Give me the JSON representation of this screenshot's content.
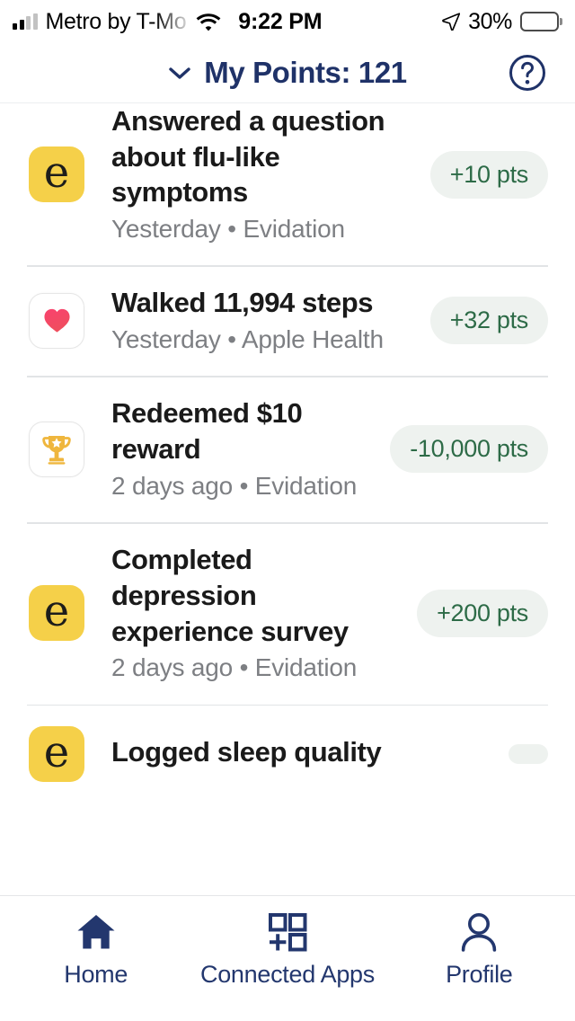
{
  "status_bar": {
    "carrier": "Metro by T-Mo",
    "time": "9:22 PM",
    "battery_percent": "30%",
    "battery_level": 30,
    "signal_icon": "signal-bars-icon",
    "wifi_icon": "wifi-icon",
    "location_icon": "location-arrow-icon",
    "battery_icon": "battery-icon"
  },
  "header": {
    "title": "My Points: 121",
    "points": 121,
    "dropdown_icon": "chevron-down-icon",
    "help_icon": "help-circle-icon"
  },
  "activity_list": [
    {
      "icon": "evidation-e-icon",
      "title": "Answered a question about flu-like symptoms",
      "subtitle": "Yesterday • Evidation",
      "badge": "+10 pts"
    },
    {
      "icon": "apple-health-heart-icon",
      "title": "Walked 11,994 steps",
      "subtitle": "Yesterday • Apple Health",
      "badge": "+32 pts"
    },
    {
      "icon": "trophy-icon",
      "title": "Redeemed $10 reward",
      "subtitle": "2 days ago • Evidation",
      "badge": "-10,000 pts"
    },
    {
      "icon": "evidation-e-icon",
      "title": "Completed depression experience survey",
      "subtitle": "2 days ago • Evidation",
      "badge": "+200 pts"
    },
    {
      "icon": "evidation-e-icon",
      "title": "Logged sleep quality",
      "subtitle": "",
      "badge": ""
    }
  ],
  "tabbar": [
    {
      "label": "Home",
      "icon": "home-icon"
    },
    {
      "label": "Connected Apps",
      "icon": "connected-apps-icon"
    },
    {
      "label": "Profile",
      "icon": "person-icon"
    }
  ],
  "colors": {
    "navy": "#1f3268",
    "badge_bg": "#eef2ef",
    "badge_text": "#2d6b47",
    "evidation_yellow": "#f5d049",
    "trophy_gold": "#efb63d"
  }
}
